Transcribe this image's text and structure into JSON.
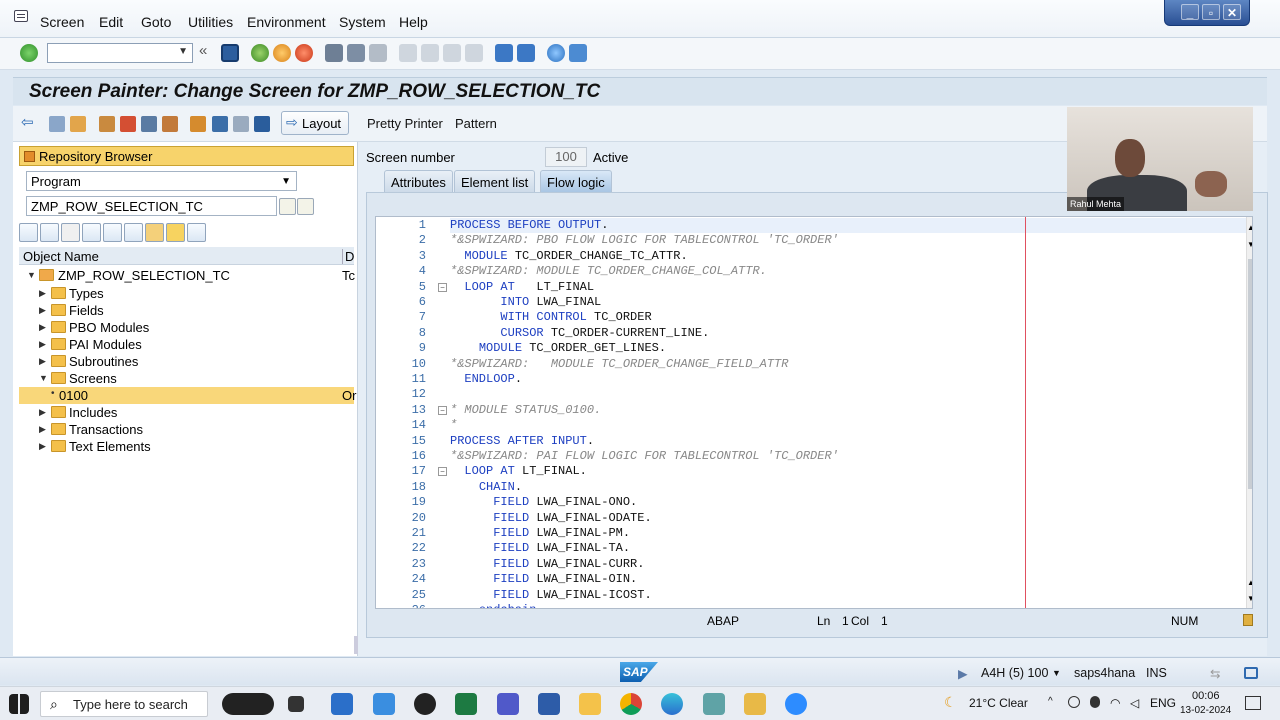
{
  "menubar": {
    "items": [
      "Screen",
      "Edit",
      "Goto",
      "Utilities",
      "Environment",
      "System",
      "Help"
    ]
  },
  "title": "Screen Painter: Change Screen for ZMP_ROW_SELECTION_TC",
  "appbar": {
    "layout_label": "Layout",
    "pretty_printer_label": "Pretty Printer",
    "pattern_label": "Pattern"
  },
  "left": {
    "repo_label": "Repository Browser",
    "object_type": "Program",
    "object_name": "ZMP_ROW_SELECTION_TC",
    "tree_header_name": "Object Name",
    "tree_header_col2": "D",
    "tree": [
      {
        "label": "ZMP_ROW_SELECTION_TC",
        "col2": "Tc"
      },
      {
        "label": "Types"
      },
      {
        "label": "Fields"
      },
      {
        "label": "PBO Modules"
      },
      {
        "label": "PAI Modules"
      },
      {
        "label": "Subroutines"
      },
      {
        "label": "Screens"
      },
      {
        "label": "0100",
        "col2": "Or"
      },
      {
        "label": "Includes"
      },
      {
        "label": "Transactions"
      },
      {
        "label": "Text Elements"
      }
    ]
  },
  "right": {
    "screen_number_label": "Screen number",
    "screen_number": "100",
    "status": "Active",
    "tabs": [
      "Attributes",
      "Element list",
      "Flow logic"
    ],
    "active_tab": "Flow logic",
    "code_lines": [
      "PROCESS BEFORE OUTPUT.",
      "*&SPWIZARD: PBO FLOW LOGIC FOR TABLECONTROL 'TC_ORDER'",
      "  MODULE TC_ORDER_CHANGE_TC_ATTR.",
      "*&SPWIZARD: MODULE TC_ORDER_CHANGE_COL_ATTR.",
      "  LOOP AT   LT_FINAL",
      "       INTO LWA_FINAL",
      "       WITH CONTROL TC_ORDER",
      "       CURSOR TC_ORDER-CURRENT_LINE.",
      "    MODULE TC_ORDER_GET_LINES.",
      "*&SPWIZARD:   MODULE TC_ORDER_CHANGE_FIELD_ATTR",
      "  ENDLOOP.",
      "",
      "* MODULE STATUS_0100.",
      "*",
      "PROCESS AFTER INPUT.",
      "*&SPWIZARD: PAI FLOW LOGIC FOR TABLECONTROL 'TC_ORDER'",
      "  LOOP AT LT_FINAL.",
      "    CHAIN.",
      "      FIELD LWA_FINAL-ONO.",
      "      FIELD LWA_FINAL-ODATE.",
      "      FIELD LWA_FINAL-PM.",
      "      FIELD LWA_FINAL-TA.",
      "      FIELD LWA_FINAL-CURR.",
      "      FIELD LWA_FINAL-OIN.",
      "      FIELD LWA_FINAL-ICOST.",
      "    endchain."
    ],
    "editor_status": {
      "language": "ABAP",
      "ln_label": "Ln",
      "ln": "1",
      "col_label": "Col",
      "col": "1",
      "num": "NUM"
    }
  },
  "statusbar": {
    "sap_logo": "SAP",
    "system": "A4H (5) 100",
    "server": "saps4hana",
    "mode": "INS"
  },
  "webcam": {
    "name": "Rahul Mehta"
  },
  "taskbar": {
    "search_placeholder": "Type here to search",
    "weather": "21°C  Clear",
    "lang": "ENG",
    "time": "00:06",
    "date": "13-02-2024"
  }
}
